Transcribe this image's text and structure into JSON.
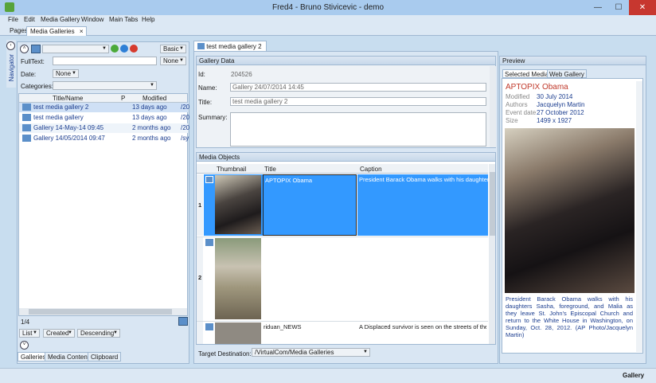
{
  "window": {
    "title": "Fred4 - Bruno Stivicevic - demo",
    "min": "—",
    "max": "☐",
    "close": "✕"
  },
  "menu": {
    "file": "File",
    "edit": "Edit",
    "media_gallery": "Media Gallery",
    "window": "Window",
    "main_tabs": "Main Tabs",
    "help": "Help"
  },
  "tabs": {
    "pages": "Pages",
    "media_galleries": "Media Galleries",
    "close": "×"
  },
  "navigator": {
    "label": "Navigator",
    "basic": "Basic",
    "fulltext_label": "FullText:",
    "fulltext_value": "",
    "none1": "None",
    "date_label": "Date:",
    "date_value": "None",
    "categories_label": "Categories:",
    "columns": {
      "title": "Title/Name",
      "p": "P",
      "modified": "Modified"
    },
    "rows": [
      {
        "title": "test media gallery 2",
        "modified": "13 days ago",
        "extra": "/20"
      },
      {
        "title": "test media gallery",
        "modified": "13 days ago",
        "extra": "/20"
      },
      {
        "title": "Gallery 14-May-14 09:45",
        "modified": "2 months ago",
        "extra": "/20"
      },
      {
        "title": "Gallery 14/05/2014 09:47",
        "modified": "2 months ago",
        "extra": "/sy"
      }
    ],
    "page_count": "1/4",
    "sort_list": "List",
    "sort_created": "Created",
    "sort_desc": "Descending",
    "bottom_tabs": [
      "Galleries",
      "Media Content",
      "Clipboard"
    ]
  },
  "doc_tab": {
    "label": "test media gallery 2",
    "close": "×"
  },
  "gallery_data": {
    "header": "Gallery Data",
    "id_label": "Id:",
    "id_value": "204526",
    "name_label": "Name:",
    "name_value": "Gallery 24/07/2014 14:45",
    "title_label": "Title:",
    "title_value": "test media gallery 2",
    "summary_label": "Summary:"
  },
  "media_objects": {
    "header": "Media Objects",
    "columns": {
      "thumbnail": "Thumbnail",
      "title": "Title",
      "caption": "Caption"
    },
    "rows": [
      {
        "num": "1",
        "title": "APTOPIX Obama",
        "caption": "President Barack Obama walks with his daughters Sasha, foreground, and Malia as they leave St. John's Episcopal Church and return to the White House in Washington, on Sunday, Oct. 28, 2012. (AP Photo/Jacquelyn Martin)"
      },
      {
        "num": "2",
        "title": "",
        "caption": ""
      },
      {
        "num": "",
        "title": "riduan_NEWS",
        "caption": "A Displaced survivor is seen on the streets of the typhoon-ravaged Tacloban city, which is the coastal capital of Leyte province"
      }
    ],
    "target_label": "Target Destination:",
    "target_value": "/VirtualCom/Media Galleries"
  },
  "preview": {
    "header": "Preview",
    "tabs": [
      "Selected Media",
      "Web Gallery"
    ],
    "title": "APTOPIX Obama",
    "fields": [
      {
        "label": "Modified",
        "value": "30 July 2014"
      },
      {
        "label": "Authors",
        "value": "Jacquelyn Martin"
      },
      {
        "label": "Event date",
        "value": "27 October 2012"
      },
      {
        "label": "Size",
        "value": "1499 x 1927"
      }
    ],
    "caption": "President Barack Obama walks with his daughters Sasha, foreground, and Malia as they leave St. John's Episcopal Church and return to the White House in Washington, on Sunday, Oct. 28, 2012. (AP Photo/Jacquelyn Martin)"
  },
  "status": {
    "right": "Gallery"
  },
  "colors": {
    "accent": "#3399ff",
    "link": "#1b3d8f",
    "title_red": "#c0392b"
  }
}
